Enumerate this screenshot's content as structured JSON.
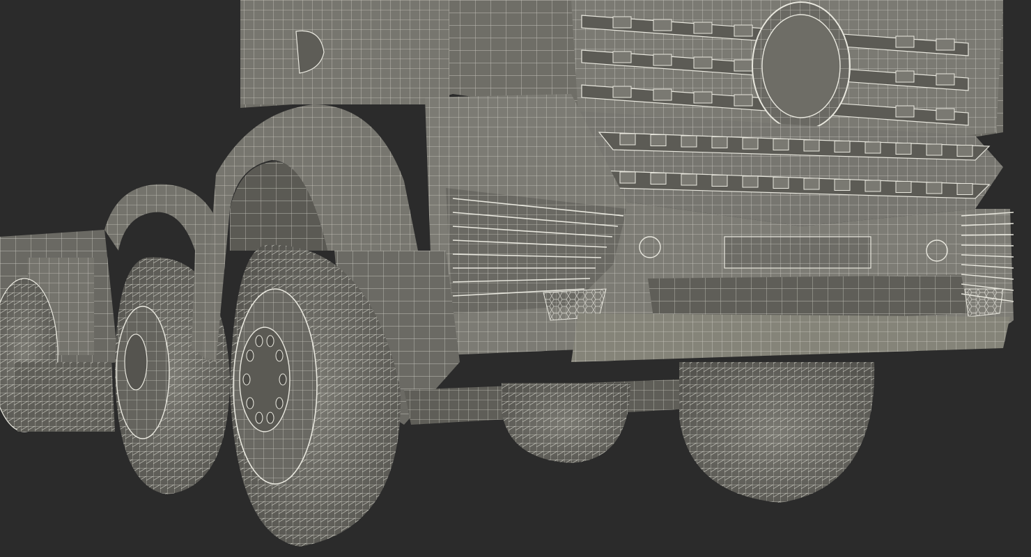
{
  "scene": {
    "subject": "truck-wireframe-render",
    "background_color": "#2b2b2b",
    "surface_color": "#6e6d66",
    "surface_light": "#8a8981",
    "surface_dark": "#4d4c47",
    "wire_color": "#e9e8df",
    "wire_soft": "#c9c8bf"
  }
}
